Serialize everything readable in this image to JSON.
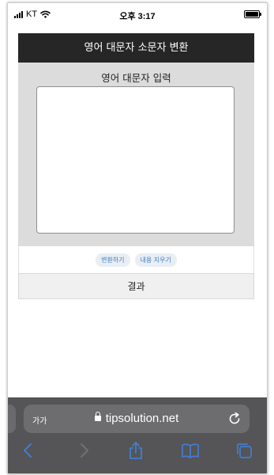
{
  "status_bar": {
    "carrier": "KT",
    "time": "오후 3:17"
  },
  "app": {
    "title": "영어 대문자 소문자 변환",
    "input_label": "영어 대문자 입력",
    "input_value": "",
    "convert_button": "변환하기",
    "clear_button": "내용 지우기",
    "result_label": "결과"
  },
  "browser": {
    "text_size_label": "가가",
    "url": "tipsolution.net",
    "accent_color": "#3b7fc4",
    "toolbar_icons": [
      "back-icon",
      "forward-icon",
      "share-icon",
      "bookmarks-icon",
      "tabs-icon"
    ]
  }
}
